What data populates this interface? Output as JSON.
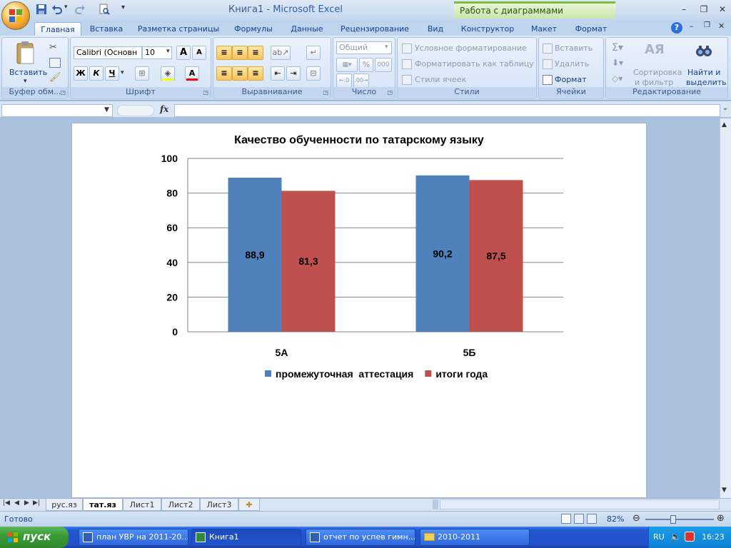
{
  "window": {
    "title_doc": "Книга1",
    "title_sep": " - ",
    "title_app": "Microsoft Excel",
    "context_title": "Работа с диаграммами",
    "minimize": "–",
    "restore": "❐",
    "close": "✕"
  },
  "tabs": [
    {
      "label": "Главная",
      "active": true
    },
    {
      "label": "Вставка"
    },
    {
      "label": "Разметка страницы"
    },
    {
      "label": "Формулы"
    },
    {
      "label": "Данные"
    },
    {
      "label": "Рецензирование"
    },
    {
      "label": "Вид"
    },
    {
      "label": "Конструктор"
    },
    {
      "label": "Макет"
    },
    {
      "label": "Формат"
    }
  ],
  "ribbon": {
    "clipboard": {
      "label": "Буфер обм...",
      "paste": "Вставить"
    },
    "font": {
      "label": "Шрифт",
      "font_name": "Calibri (Основн",
      "font_size": "10",
      "bold": "Ж",
      "italic": "К",
      "underline": "Ч",
      "grow": "A",
      "shrink": "A",
      "font_color": "A"
    },
    "alignment": {
      "label": "Выравнивание"
    },
    "number": {
      "label": "Число",
      "format": "Общий",
      "percent": "%",
      "thousands": "000"
    },
    "styles": {
      "label": "Стили",
      "conditional": "Условное форматирование",
      "as_table": "Форматировать как таблицу",
      "cell_styles": "Стили ячеек"
    },
    "cells": {
      "label": "Ячейки",
      "insert": "Вставить",
      "delete": "Удалить",
      "format": "Формат"
    },
    "editing": {
      "label": "Редактирование",
      "sort_line1": "Сортировка",
      "sort_line2": "и фильтр",
      "find_line1": "Найти и",
      "find_line2": "выделить"
    }
  },
  "formula_bar": {
    "name_box": "",
    "fx": "fx",
    "formula": ""
  },
  "chart_data": {
    "type": "bar",
    "title": "Качество обученности по татарскому языку",
    "categories": [
      "5А",
      "5Б"
    ],
    "series": [
      {
        "name": "промежуточная  аттестация",
        "values": [
          88.9,
          90.2
        ],
        "labels": [
          "88,9",
          "90,2"
        ],
        "color": "#4f81bd"
      },
      {
        "name": "итоги года",
        "values": [
          81.3,
          87.5
        ],
        "labels": [
          "81,3",
          "87,5"
        ],
        "color": "#c0504d"
      }
    ],
    "ylim": [
      0,
      100
    ],
    "yticks": [
      "0",
      "20",
      "40",
      "60",
      "80",
      "100"
    ],
    "grid": true,
    "legend": "bottom"
  },
  "sheets": [
    {
      "label": "рус.яз"
    },
    {
      "label": "тат.яз",
      "active": true
    },
    {
      "label": "Лист1"
    },
    {
      "label": "Лист2"
    },
    {
      "label": "Лист3"
    }
  ],
  "status": {
    "ready": "Готово",
    "zoom": "82%",
    "zoom_level": 0.41
  },
  "taskbar": {
    "start": "пуск",
    "tasks": [
      "план УВР на 2011-20...",
      "Книга1",
      "отчет по успев гимн...",
      "2010-2011"
    ],
    "lang": "RU",
    "time": "16:23"
  }
}
